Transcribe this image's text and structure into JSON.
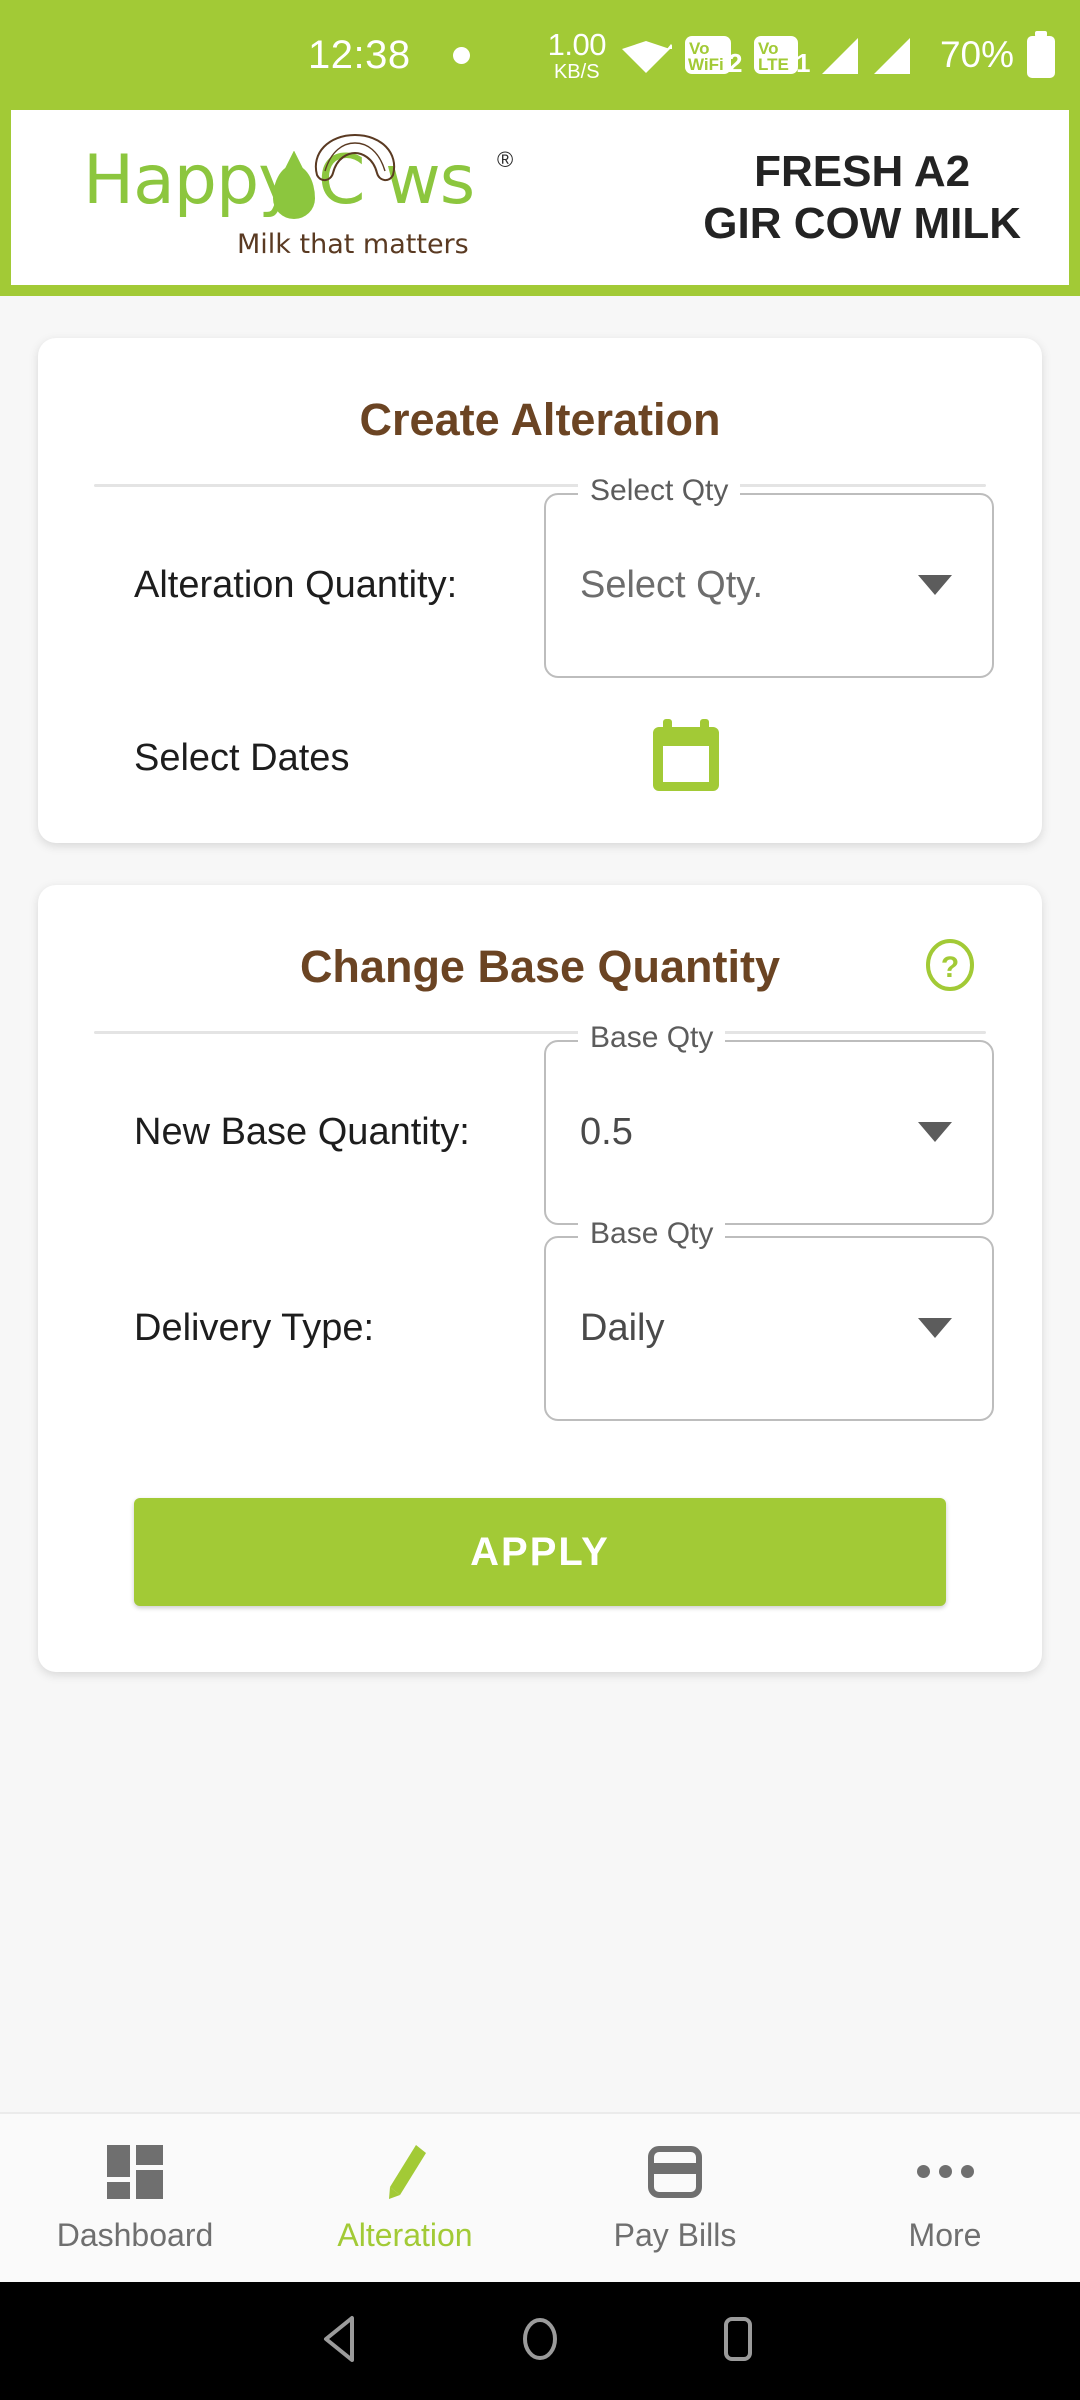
{
  "status_bar": {
    "time": "12:38",
    "network_speed_value": "1.00",
    "network_speed_unit": "KB/S",
    "volte_label_top": "Vo",
    "volte_label_bottom": "WiFi",
    "volte_sim_wifi": "2",
    "volte2_label_top": "Vo",
    "volte2_label_bottom": "LTE",
    "volte_sim_lte": "1",
    "battery_percent": "70%",
    "icons": [
      "dot-icon",
      "wifi-icon",
      "volte-wifi-icon",
      "volte-lte-icon",
      "signal-bars-icon",
      "battery-icon"
    ]
  },
  "header": {
    "logo_word": "Happy C  ws",
    "logo_registered": "®",
    "logo_tagline": "Milk that matters",
    "title_line1": "FRESH A2",
    "title_line2": "GIR COW MILK"
  },
  "create_alteration_card": {
    "title": "Create Alteration",
    "quantity_label": "Alteration Quantity:",
    "quantity_float_label": "Select Qty",
    "quantity_value": "Select Qty.",
    "dates_label": "Select Dates",
    "calendar_icon": "calendar-icon"
  },
  "change_base_quantity_card": {
    "title": "Change Base Quantity",
    "help_icon": "help-circle-icon",
    "new_base_quantity_label": "New Base Quantity:",
    "new_base_quantity_float_label": "Base Qty",
    "new_base_quantity_value": "0.5",
    "delivery_type_label": "Delivery Type:",
    "delivery_type_float_label": "Base Qty",
    "delivery_type_value": "Daily",
    "apply_label": "APPLY"
  },
  "bottom_nav": {
    "items": [
      {
        "label": "Dashboard",
        "icon": "grid-icon",
        "active": false
      },
      {
        "label": "Alteration",
        "icon": "pencil-icon",
        "active": true
      },
      {
        "label": "Pay Bills",
        "icon": "credit-card-icon",
        "active": false
      },
      {
        "label": "More",
        "icon": "ellipsis-icon",
        "active": false
      }
    ]
  },
  "android_nav": {
    "back_icon": "back-triangle-icon",
    "home_icon": "home-circle-icon",
    "recents_icon": "recents-square-icon"
  },
  "colors": {
    "brand_green": "#a2ca36",
    "logo_green": "#8cc63e",
    "title_brown": "#6b4423",
    "page_background": "#f7f7f7",
    "card_white": "#ffffff"
  }
}
